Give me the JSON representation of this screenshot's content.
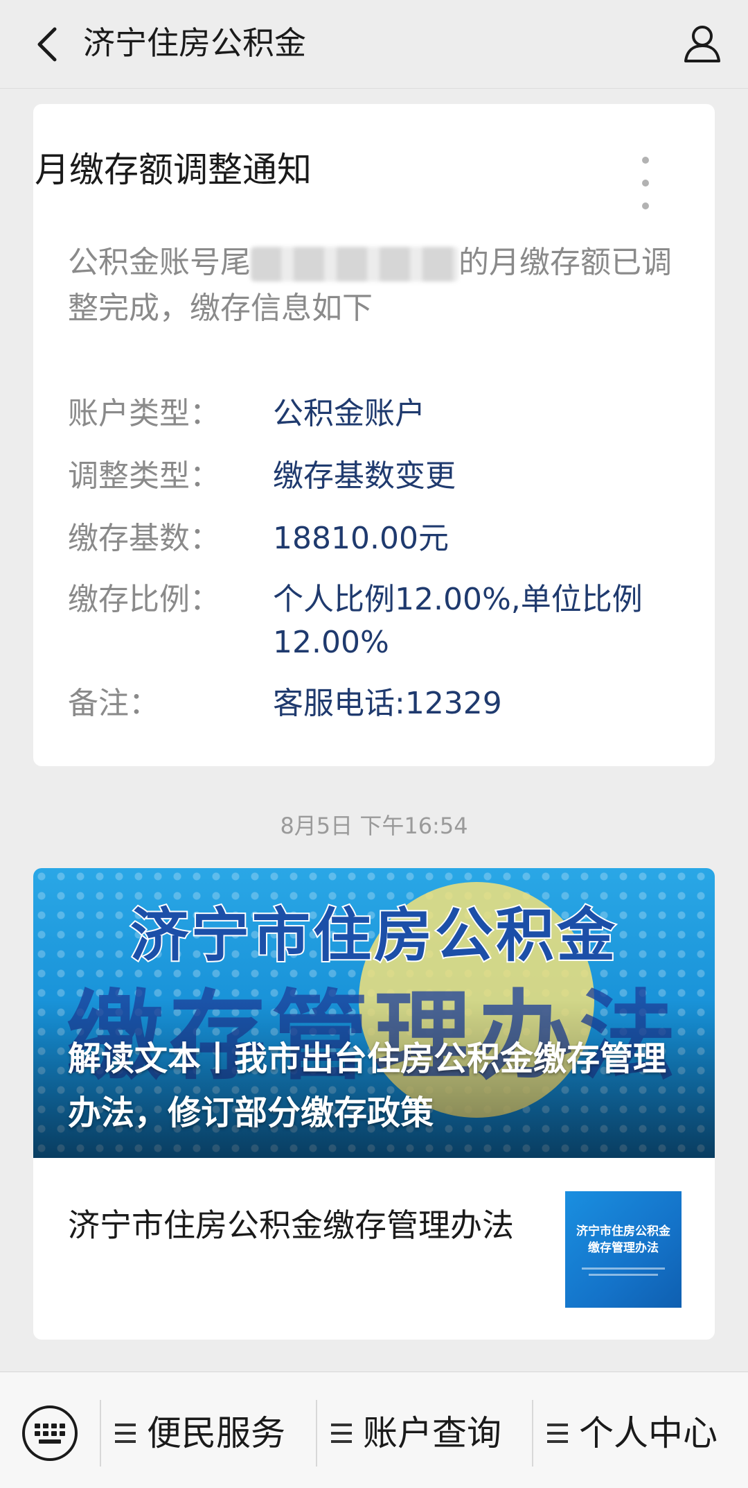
{
  "navbar": {
    "back_icon": "chevron-left-icon",
    "title": "济宁住房公积金",
    "user_icon": "user-profile-icon"
  },
  "notice": {
    "title": "月缴存额调整通知",
    "more_icon": "more-vertical-icon",
    "desc_prefix": "公积金账号尾",
    "desc_suffix": "的月缴存额已调整完成，缴存信息如下",
    "fields": [
      {
        "label": "账户类型：",
        "value": "公积金账户"
      },
      {
        "label": "调整类型：",
        "value": "缴存基数变更"
      },
      {
        "label": "缴存基数：",
        "value": "18810.00元"
      },
      {
        "label": "缴存比例：",
        "value": "个人比例12.00%,单位比例12.00%"
      },
      {
        "label": "备注：",
        "value": "客服电话:12329"
      }
    ]
  },
  "timestamp": "8月5日 下午16:54",
  "article": {
    "cover_banner_line1": "济宁市住房公积金",
    "cover_banner_line2": "缴存管理办法",
    "cover_title": "解读文本丨我市出台住房公积金缴存管理办法，修订部分缴存政策",
    "item_title": "济宁市住房公积金缴存管理办法",
    "thumb_line1": "济宁市住房公积金",
    "thumb_line2": "缴存管理办法"
  },
  "bottom_menu": {
    "keyboard_icon": "keyboard-icon",
    "items": [
      {
        "label": "便民服务",
        "icon": "menu-lines-icon"
      },
      {
        "label": "账户查询",
        "icon": "menu-lines-icon"
      },
      {
        "label": "个人中心",
        "icon": "menu-lines-icon"
      }
    ]
  },
  "colors": {
    "background": "#ededed",
    "card": "#ffffff",
    "value_text": "#1f3a6e",
    "label_text": "#8a8a8a"
  }
}
